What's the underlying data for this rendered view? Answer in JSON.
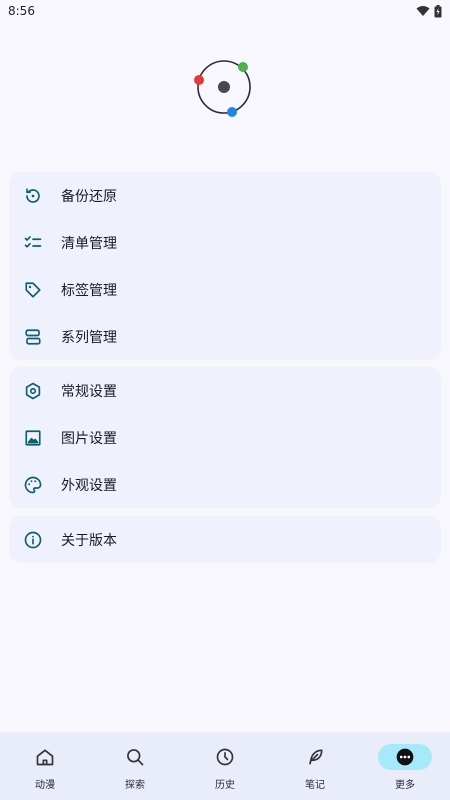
{
  "status_bar": {
    "time": "8:56",
    "icons": [
      "wifi-icon",
      "battery-icon"
    ]
  },
  "colors": {
    "accent": "#0e5f6b",
    "group_bg": "#eff2fd",
    "nav_active": "#a6e9fb",
    "dot_red": "#e53935",
    "dot_green": "#4caf50",
    "dot_blue": "#1e88e5"
  },
  "groups": [
    {
      "items": [
        {
          "icon": "restore-icon",
          "label": "备份还原"
        },
        {
          "icon": "checklist-icon",
          "label": "清单管理"
        },
        {
          "icon": "tag-icon",
          "label": "标签管理"
        },
        {
          "icon": "series-icon",
          "label": "系列管理"
        }
      ]
    },
    {
      "items": [
        {
          "icon": "settings-hex-icon",
          "label": "常规设置"
        },
        {
          "icon": "image-icon",
          "label": "图片设置"
        },
        {
          "icon": "palette-icon",
          "label": "外观设置"
        }
      ]
    },
    {
      "items": [
        {
          "icon": "info-icon",
          "label": "关于版本"
        }
      ]
    }
  ],
  "bottom_nav": [
    {
      "icon": "home-icon",
      "label": "动漫",
      "active": false
    },
    {
      "icon": "search-icon",
      "label": "探索",
      "active": false
    },
    {
      "icon": "clock-icon",
      "label": "历史",
      "active": false
    },
    {
      "icon": "feather-icon",
      "label": "笔记",
      "active": false
    },
    {
      "icon": "more-icon",
      "label": "更多",
      "active": true
    }
  ]
}
